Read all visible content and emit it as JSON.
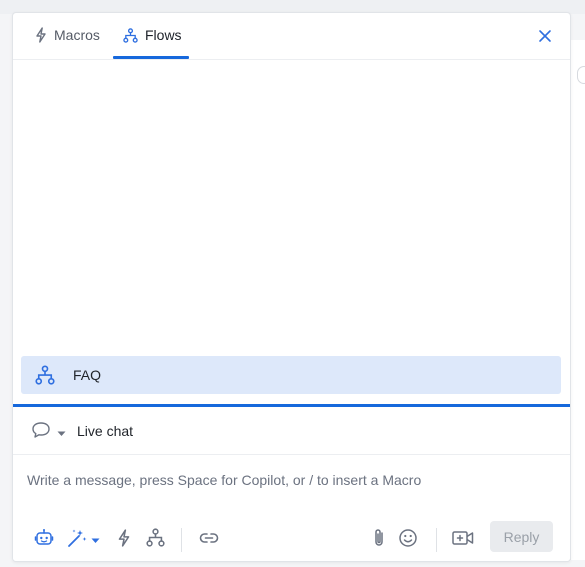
{
  "tabs": [
    {
      "label": "Macros",
      "icon": "lightning-icon",
      "active": false
    },
    {
      "label": "Flows",
      "icon": "flow-icon",
      "active": true
    }
  ],
  "flows": [
    {
      "label": "FAQ",
      "icon": "flow-icon",
      "selected": true
    }
  ],
  "composer": {
    "channel_label": "Live chat",
    "placeholder": "Write a message, press Space for Copilot, or / to insert a Macro",
    "message_value": "",
    "reply_label": "Reply"
  },
  "toolbar_icons": [
    "copilot-bot-icon",
    "magic-wand-icon",
    "lightning-icon",
    "flow-icon",
    "link-icon",
    "paperclip-icon",
    "emoji-icon",
    "video-icon"
  ],
  "colors": {
    "accent": "#1668dc",
    "selected_bg": "#dde8fa",
    "icon_blue": "#2f6fe0",
    "icon_gray": "#6b7280"
  }
}
